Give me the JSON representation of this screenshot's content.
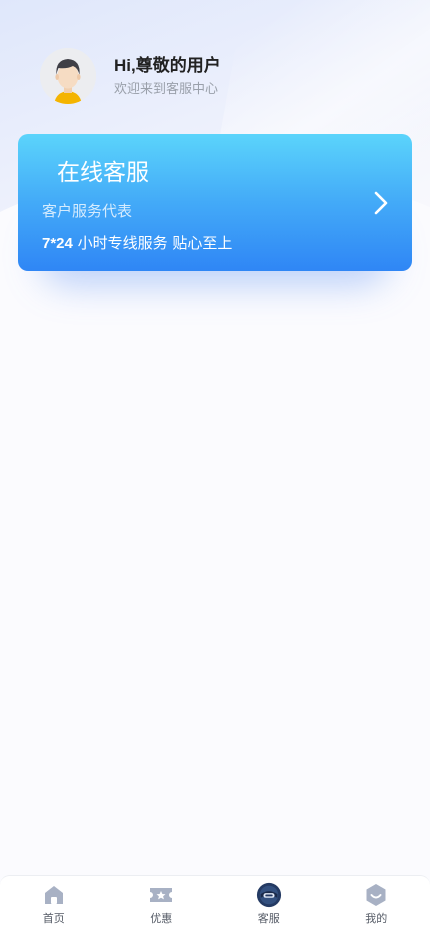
{
  "header": {
    "greeting": "Hi,尊敬的用户",
    "subtitle": "欢迎来到客服中心",
    "avatar_icon": "user-avatar-icon"
  },
  "service_card": {
    "title": "在线客服",
    "subtitle": "客户服务代表",
    "slogan_prefix": "7*24",
    "slogan_rest": " 小时专线服务 贴心至上",
    "arrow_icon": "chevron-right-icon",
    "gradient_top": "#5bd4fb",
    "gradient_bottom": "#2f86f5"
  },
  "tabbar": {
    "items": [
      {
        "label": "首页",
        "icon": "home-icon",
        "active": false
      },
      {
        "label": "优惠",
        "icon": "coupon-icon",
        "active": false
      },
      {
        "label": "客服",
        "icon": "customer-service-icon",
        "active": true
      },
      {
        "label": "我的",
        "icon": "profile-icon",
        "active": false
      }
    ],
    "inactive_icon_color": "#a8b1c4",
    "active_icon_color": "#243a63"
  }
}
